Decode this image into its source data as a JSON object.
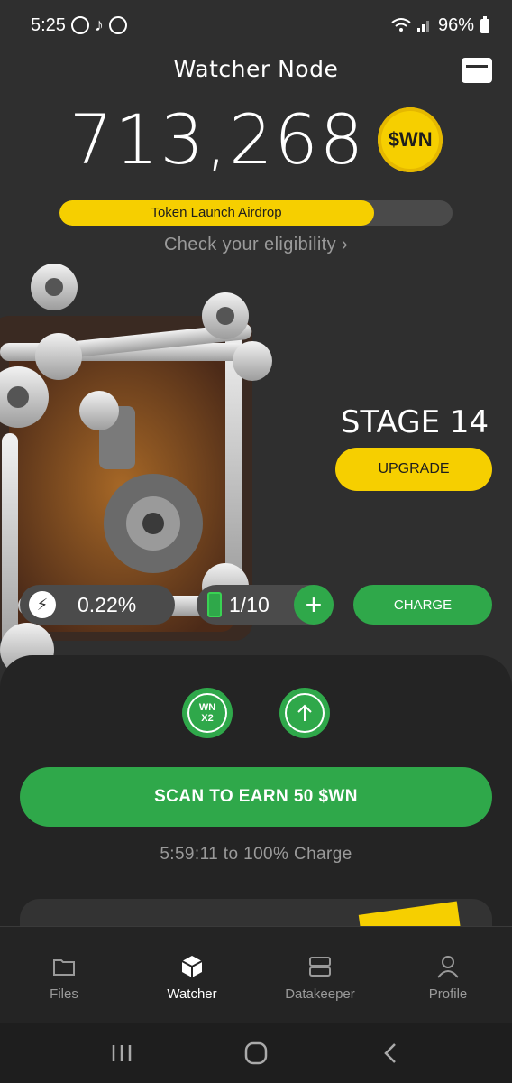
{
  "status_bar": {
    "time": "5:25",
    "battery": "96%"
  },
  "header": {
    "title": "Watcher Node",
    "wallet_icon": "wallet-icon"
  },
  "balance": {
    "value": "713,268",
    "token_badge": "$WN"
  },
  "airdrop": {
    "label": "Token Launch Airdrop",
    "progress": 0.8,
    "link_text": "Check your eligibility ›"
  },
  "stage": {
    "title": "STAGE 14",
    "upgrade_label": "UPGRADE"
  },
  "stats": {
    "rate_icon": "lightning-icon",
    "rate": "0.22%",
    "battery_icon": "battery-icon",
    "battery_count": "1/10",
    "plus_label": "+",
    "charge_label": "CHARGE"
  },
  "boosts": {
    "multiplier_line1": "WN",
    "multiplier_line2": "X2",
    "upload_icon": "arrow-up-icon"
  },
  "scan": {
    "label": "SCAN TO EARN 50 $WN",
    "timer": "5:59:11 to 100% Charge"
  },
  "task_card": {},
  "nav": {
    "items": [
      {
        "label": "Files",
        "icon": "folder-icon"
      },
      {
        "label": "Watcher",
        "icon": "cube-icon"
      },
      {
        "label": "Datakeeper",
        "icon": "server-icon"
      },
      {
        "label": "Profile",
        "icon": "person-icon"
      }
    ]
  },
  "colors": {
    "background": "#2f2f2f",
    "accent_yellow": "#f6cf00",
    "accent_green": "#2fa84a"
  }
}
